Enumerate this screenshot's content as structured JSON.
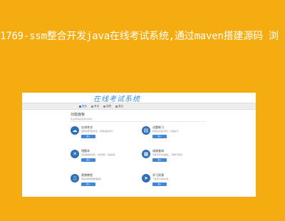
{
  "banner": {
    "title": "1769-ssm整合开发java在线考试系统,通过maven搭建源码 浏"
  },
  "screenshot": {
    "logo": "在线考试系统",
    "nav": [
      {
        "label": "首页",
        "icon": "home-icon",
        "active": true
      },
      {
        "label": "考试",
        "icon": "edit-icon",
        "active": false
      },
      {
        "label": "成绩",
        "icon": "chart-icon",
        "active": false
      },
      {
        "label": "退出",
        "icon": "logout-icon",
        "active": false
      }
    ],
    "page_title": "功能面板",
    "page_sub": "欢迎使用在线考试系统",
    "cards": [
      {
        "title": "在线考试",
        "desc": "选择试卷开始考试，交卷后自动评分",
        "button": "进入",
        "icon": "cloud-icon"
      },
      {
        "title": "试题练习",
        "desc": "按知识点进行练习，巩固复习",
        "button": "进入",
        "icon": "book-icon"
      },
      {
        "title": "错题本",
        "desc": "查看做错的试题，分析原因，查漏补缺",
        "button": "进入",
        "icon": "x-icon"
      },
      {
        "title": "成绩查询",
        "desc": "查看历次考试成绩，了解学习情况",
        "button": "进入",
        "icon": "document-icon"
      },
      {
        "title": "视频教程",
        "desc": "观看系统视频教程资料",
        "button": "进入",
        "icon": "phone-icon"
      },
      {
        "title": "学习资源",
        "desc": "下载学习资料文档",
        "button": "进入",
        "icon": "send-icon"
      }
    ],
    "colors": {
      "accent": "#2f6fb5",
      "background": "#f5ac10"
    }
  }
}
